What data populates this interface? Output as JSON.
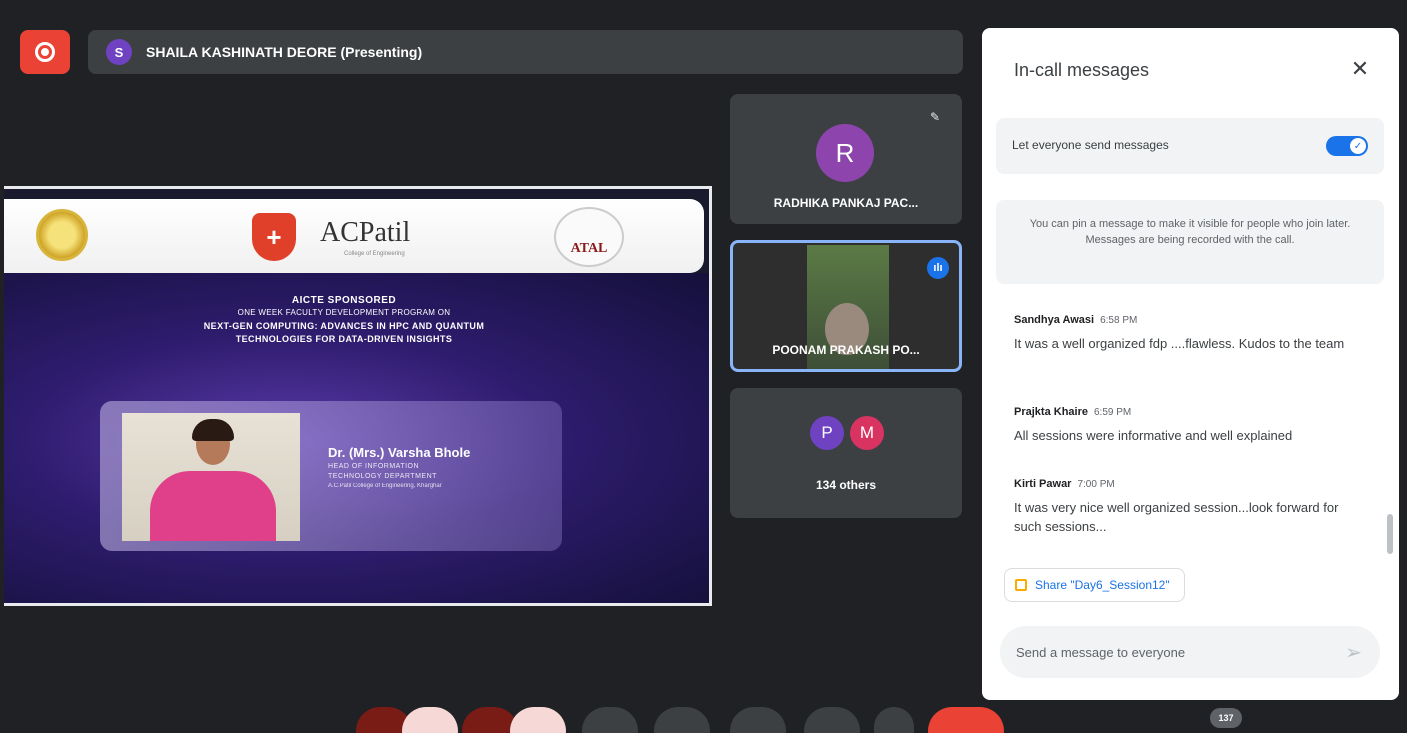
{
  "presenter": {
    "initial": "S",
    "name": "SHAILA KASHINATH DEORE (Presenting)"
  },
  "slide": {
    "logo_name": "ACPatil",
    "logo_sub": "College of Engineering",
    "logo_right": "ATAL",
    "line1": "AICTE SPONSORED",
    "line2": "ONE WEEK FACULTY DEVELOPMENT PROGRAM ON",
    "line3": "NEXT-GEN COMPUTING: ADVANCES IN HPC AND QUANTUM",
    "line4": "TECHNOLOGIES FOR DATA-DRIVEN INSIGHTS",
    "speaker_name": "Dr. (Mrs.) Varsha Bhole",
    "speaker_role1": "HEAD OF INFORMATION",
    "speaker_role2": "TECHNOLOGY DEPARTMENT",
    "speaker_org": "A.C.Patil College of Engineering, Kharghar"
  },
  "tiles": {
    "r_initial": "R",
    "r_name": "RADHIKA PANKAJ PAC...",
    "p_name": "POONAM PRAKASH PO...",
    "others_initials": [
      "P",
      "M"
    ],
    "others_label": "134 others"
  },
  "chat": {
    "title": "In-call messages",
    "toggle_label": "Let everyone send messages",
    "pin_note": "You can pin a message to make it visible for people who join later. Messages are being recorded with the call.",
    "messages": [
      {
        "sender": "Sandhya Awasi",
        "time": "6:58 PM",
        "text": "It was a well organized fdp ....flawless.  Kudos to the team"
      },
      {
        "sender": "Prajkta Khaire",
        "time": "6:59 PM",
        "text": "All sessions were informative and well explained"
      },
      {
        "sender": "Kirti Pawar",
        "time": "7:00 PM",
        "text": "It was very nice well organized session...look forward for such sessions..."
      }
    ],
    "share_chip": "Share \"Day6_Session12\"",
    "input_placeholder": "Send a message to everyone"
  },
  "controls": {
    "participant_count": "137"
  },
  "colors": {
    "accent": "#1a73e8",
    "record": "#ea4335",
    "bg": "#202124"
  }
}
